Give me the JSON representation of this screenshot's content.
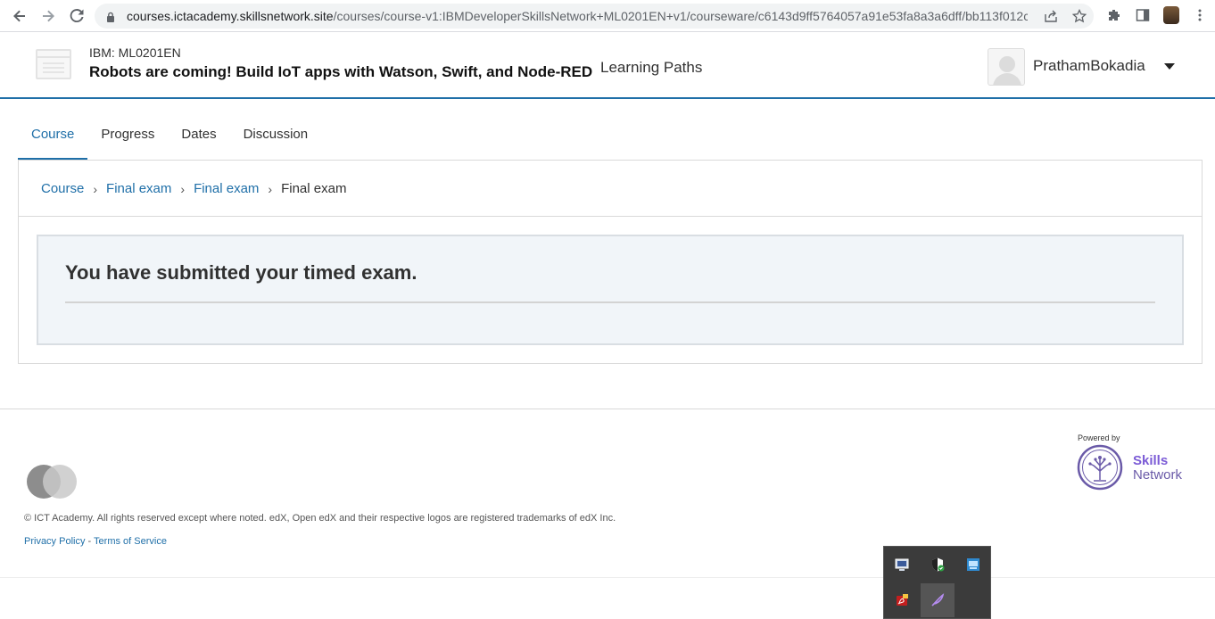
{
  "browser": {
    "url_host": "courses.ictacademy.skillsnetwork.site",
    "url_path": "/courses/course-v1:IBMDeveloperSkillsNetwork+ML0201EN+v1/courseware/c6143d9ff5764057a91e53fa8a3a6dff/bb113f012c..."
  },
  "header": {
    "course_org": "IBM: ML0201EN",
    "course_title": "Robots are coming! Build IoT apps with Watson, Swift, and Node-RED",
    "learning_paths": "Learning Paths",
    "username": "PrathamBokadia"
  },
  "tabs": [
    {
      "label": "Course",
      "active": true
    },
    {
      "label": "Progress",
      "active": false
    },
    {
      "label": "Dates",
      "active": false
    },
    {
      "label": "Discussion",
      "active": false
    }
  ],
  "breadcrumb": {
    "items": [
      "Course",
      "Final exam",
      "Final exam"
    ],
    "current": "Final exam",
    "separator": "›"
  },
  "notice": {
    "message": "You have submitted your timed exam."
  },
  "footer": {
    "copyright": "© ICT Academy. All rights reserved except where noted. edX, Open edX and their respective logos are registered trademarks of edX Inc.",
    "privacy": "Privacy Policy",
    "link_sep": " - ",
    "terms": "Terms of Service",
    "powered_by": "Powered by",
    "brand_line1": "Skills",
    "brand_line2": "Network"
  },
  "colors": {
    "link": "#1f6fa8",
    "notice_bg": "#f1f5f9",
    "brand_purple": "#7b5bd6"
  },
  "tray_icons": [
    "monitor-icon",
    "shield-icon",
    "network-icon",
    "pdf-icon",
    "feather-icon"
  ]
}
